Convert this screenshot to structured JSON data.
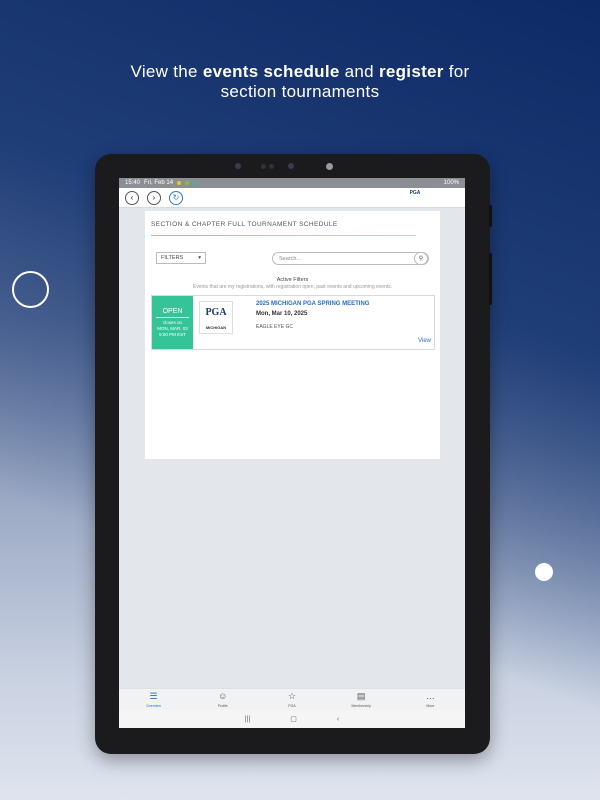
{
  "promo": {
    "line1_pre": "View the ",
    "line1_bold1": "events schedule",
    "line1_mid": " and ",
    "line1_bold2": "register",
    "line1_post": " for",
    "line2": "section tournaments"
  },
  "statusbar": {
    "time": "15:40",
    "date": "Fri, Feb 14",
    "battery": "100%"
  },
  "appbar": {
    "back_icon": "chevron-left-icon",
    "forward_icon": "chevron-right-icon",
    "refresh_icon": "refresh-icon",
    "logo_text": "PGA"
  },
  "page": {
    "section_title": "SECTION & CHAPTER FULL TOURNAMENT SCHEDULE",
    "filters_label": "FILTERS",
    "search_placeholder": "Search...",
    "active_filters_label": "Active Filters",
    "active_filters_desc": "Events that are my registrations, with registration open, past events and upcoming events."
  },
  "events": [
    {
      "status": "OPEN",
      "closes_label": "closes on",
      "closes_date": "MON, MAR. 03",
      "closes_time": "5:00 PM EST",
      "logo_text": "PGA",
      "logo_sub": "MICHIGAN",
      "title": "2025 MICHIGAN PGA SPRING MEETING",
      "date": "Mon, Mar 10, 2025",
      "venue": "EAGLE EYE GC",
      "view_label": "View"
    }
  ],
  "tabbar": {
    "items": [
      {
        "label": "Overview",
        "icon": "list-icon"
      },
      {
        "label": "Profile",
        "icon": "person-icon"
      },
      {
        "label": "PGA",
        "icon": "trophy-icon"
      },
      {
        "label": "Membership",
        "icon": "newspaper-icon"
      },
      {
        "label": "More",
        "icon": "more-icon"
      }
    ]
  },
  "colors": {
    "open_status": "#35c497",
    "link_blue": "#2a6cc0",
    "brand_navy": "#1d3a73"
  }
}
